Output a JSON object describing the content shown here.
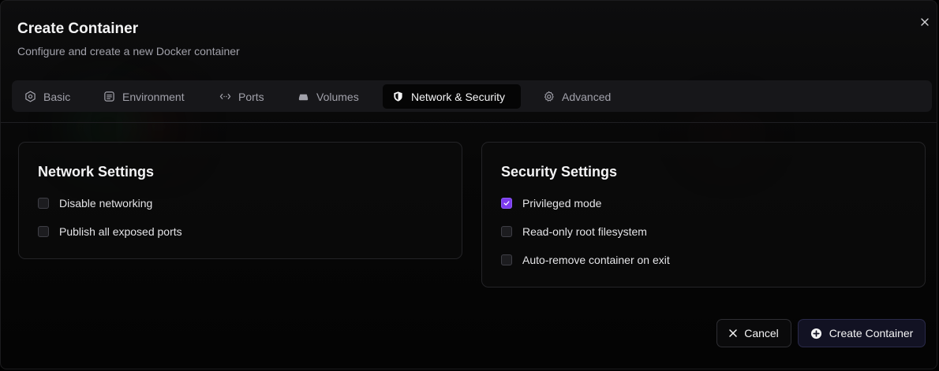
{
  "dialog": {
    "title": "Create Container",
    "subtitle": "Configure and create a new Docker container",
    "close_icon": "close-icon"
  },
  "tabs": [
    {
      "label": "Basic",
      "icon": "hexagon-settings-icon",
      "active": false
    },
    {
      "label": "Environment",
      "icon": "environment-icon",
      "active": false
    },
    {
      "label": "Ports",
      "icon": "ports-arrows-icon",
      "active": false
    },
    {
      "label": "Volumes",
      "icon": "drive-icon",
      "active": false
    },
    {
      "label": "Network & Security",
      "icon": "shield-icon",
      "active": true
    },
    {
      "label": "Advanced",
      "icon": "gear-icon",
      "active": false
    }
  ],
  "network": {
    "title": "Network Settings",
    "options": [
      {
        "label": "Disable networking",
        "checked": false
      },
      {
        "label": "Publish all exposed ports",
        "checked": false
      }
    ]
  },
  "security": {
    "title": "Security Settings",
    "options": [
      {
        "label": "Privileged mode",
        "checked": true
      },
      {
        "label": "Read-only root filesystem",
        "checked": false
      },
      {
        "label": "Auto-remove container on exit",
        "checked": false
      }
    ]
  },
  "footer": {
    "cancel_label": "Cancel",
    "create_label": "Create Container"
  },
  "colors": {
    "accent": "#7c3aed",
    "background": "#000000",
    "card_border": "#242427",
    "muted_text": "#a1a1aa"
  }
}
